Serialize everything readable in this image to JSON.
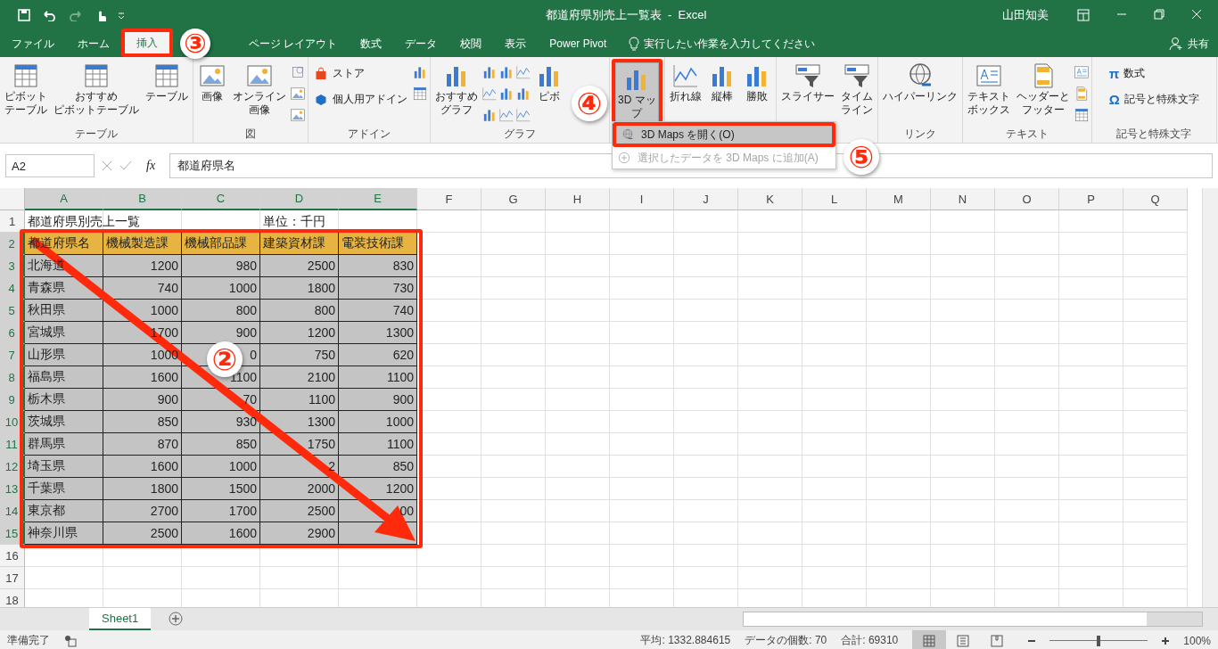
{
  "window": {
    "title": "都道府県別売上一覧表  -  Excel",
    "user": "山田知美"
  },
  "menu_tabs": [
    {
      "label": "ファイル",
      "selected": false
    },
    {
      "label": "ホーム",
      "selected": false
    },
    {
      "label": "挿入",
      "selected": true
    },
    {
      "label": "ページ レイアウト",
      "selected": false
    },
    {
      "label": "数式",
      "selected": false
    },
    {
      "label": "データ",
      "selected": false
    },
    {
      "label": "校閲",
      "selected": false
    },
    {
      "label": "表示",
      "selected": false
    },
    {
      "label": "Power Pivot",
      "selected": false
    }
  ],
  "tell_me": {
    "placeholder": "実行したい作業を入力してください"
  },
  "share": "共有",
  "ribbon_groups": [
    {
      "label": "テーブル",
      "buttons": [
        {
          "lines": [
            "ピボット",
            "テーブル"
          ],
          "kind": "large",
          "pressed": false
        },
        {
          "lines": [
            "おすすめ",
            "ピボットテーブル"
          ],
          "kind": "large",
          "pressed": false
        },
        {
          "lines": [
            "テーブル"
          ],
          "kind": "large",
          "pressed": false
        }
      ]
    },
    {
      "label": "図",
      "buttons": [
        {
          "lines": [
            "画像"
          ],
          "kind": "large",
          "pressed": false
        },
        {
          "lines": [
            "オンライン",
            "画像"
          ],
          "kind": "large",
          "pressed": false
        }
      ]
    },
    {
      "label": "アドイン",
      "buttons": [
        {
          "lines": [
            "ストア"
          ],
          "kind": "small",
          "pressed": false
        },
        {
          "lines": [
            "個人用アドイン"
          ],
          "kind": "small",
          "pressed": false
        }
      ]
    },
    {
      "label": "グラフ",
      "buttons": [
        {
          "lines": [
            "おすすめ",
            "グラフ"
          ],
          "kind": "large",
          "pressed": false
        },
        {
          "lines": [
            "ピボ"
          ],
          "kind": "large",
          "pressed": false
        }
      ]
    },
    {
      "buttons": [
        {
          "lines": [
            "3D マッ",
            "プ"
          ],
          "kind": "large",
          "pressed": true
        }
      ]
    },
    {
      "buttons": [
        {
          "lines": [
            "折れ線"
          ],
          "kind": "large",
          "pressed": false
        },
        {
          "lines": [
            "縦棒"
          ],
          "kind": "large",
          "pressed": false
        },
        {
          "lines": [
            "勝敗"
          ],
          "kind": "large",
          "pressed": false
        }
      ]
    },
    {
      "buttons": [
        {
          "lines": [
            "スライサー"
          ],
          "kind": "large",
          "pressed": false
        },
        {
          "lines": [
            "タイム",
            "ライン"
          ],
          "kind": "large",
          "pressed": false
        }
      ]
    },
    {
      "label": "リンク",
      "buttons": [
        {
          "lines": [
            "ハイパーリンク"
          ],
          "kind": "large",
          "pressed": false
        }
      ]
    },
    {
      "label": "テキスト",
      "buttons": [
        {
          "lines": [
            "テキスト",
            "ボックス"
          ],
          "kind": "large",
          "pressed": false
        },
        {
          "lines": [
            "ヘッダーと",
            "フッター"
          ],
          "kind": "large",
          "pressed": false
        }
      ]
    },
    {
      "label": "記号と特殊文字",
      "buttons": [
        {
          "lines": [
            "数式"
          ],
          "glyph": "π",
          "kind": "small",
          "pressed": false
        },
        {
          "lines": [
            "記号と特殊文字"
          ],
          "glyph": "Ω",
          "kind": "small",
          "pressed": false
        }
      ]
    }
  ],
  "dropdown_menu": [
    {
      "label": "3D Maps を開く(O)",
      "disabled": false
    },
    {
      "label": "選択したデータを 3D Maps に追加(A)",
      "disabled": true
    }
  ],
  "formula_bar": {
    "name_box": "A2",
    "function_label": "fx",
    "value": "都道府県名"
  },
  "columns": [
    {
      "label": "A",
      "selected": true
    },
    {
      "label": "B",
      "selected": true
    },
    {
      "label": "C",
      "selected": true
    },
    {
      "label": "D",
      "selected": true
    },
    {
      "label": "E",
      "selected": true
    },
    {
      "label": "F",
      "selected": false
    },
    {
      "label": "G",
      "selected": false
    },
    {
      "label": "H",
      "selected": false
    },
    {
      "label": "I",
      "selected": false
    },
    {
      "label": "J",
      "selected": false
    },
    {
      "label": "K",
      "selected": false
    },
    {
      "label": "L",
      "selected": false
    },
    {
      "label": "M",
      "selected": false
    },
    {
      "label": "N",
      "selected": false
    },
    {
      "label": "O",
      "selected": false
    },
    {
      "label": "P",
      "selected": false
    },
    {
      "label": "Q",
      "selected": false
    }
  ],
  "rows": [
    {
      "number": "1",
      "kind": "plain",
      "selected": false,
      "cells": [
        "都道府県別売上一覧",
        "",
        "",
        "単位：千円",
        ""
      ]
    },
    {
      "number": "2",
      "kind": "header",
      "selected": true,
      "cells": [
        "都道府県名",
        "機械製造課",
        "機械部品課",
        "建築資材課",
        "電装技術課"
      ]
    },
    {
      "number": "3",
      "kind": "data",
      "selected": true,
      "cells": [
        "北海道",
        "1200",
        "980",
        "2500",
        "830"
      ]
    },
    {
      "number": "4",
      "kind": "data",
      "selected": true,
      "cells": [
        "青森県",
        "740",
        "1000",
        "1800",
        "730"
      ]
    },
    {
      "number": "5",
      "kind": "data",
      "selected": true,
      "cells": [
        "秋田県",
        "1000",
        "800",
        "800",
        "740"
      ]
    },
    {
      "number": "6",
      "kind": "data",
      "selected": true,
      "cells": [
        "宮城県",
        "1700",
        "900",
        "1200",
        "1300"
      ]
    },
    {
      "number": "7",
      "kind": "data",
      "selected": true,
      "cells": [
        "山形県",
        "1000",
        "0",
        "750",
        "620"
      ]
    },
    {
      "number": "8",
      "kind": "data",
      "selected": true,
      "cells": [
        "福島県",
        "1600",
        "1100",
        "2100",
        "1100"
      ]
    },
    {
      "number": "9",
      "kind": "data",
      "selected": true,
      "cells": [
        "栃木県",
        "900",
        "70",
        "1100",
        "900"
      ]
    },
    {
      "number": "10",
      "kind": "data",
      "selected": true,
      "cells": [
        "茨城県",
        "850",
        "930",
        "1300",
        "1000"
      ]
    },
    {
      "number": "11",
      "kind": "data",
      "selected": true,
      "cells": [
        "群馬県",
        "870",
        "850",
        "1750",
        "1100"
      ]
    },
    {
      "number": "12",
      "kind": "data",
      "selected": true,
      "cells": [
        "埼玉県",
        "1600",
        "1000",
        "2",
        "850"
      ]
    },
    {
      "number": "13",
      "kind": "data",
      "selected": true,
      "cells": [
        "千葉県",
        "1800",
        "1500",
        "2000",
        "1200"
      ]
    },
    {
      "number": "14",
      "kind": "data",
      "selected": true,
      "cells": [
        "東京都",
        "2700",
        "1700",
        "2500",
        "00"
      ]
    },
    {
      "number": "15",
      "kind": "data",
      "selected": true,
      "cells": [
        "神奈川県",
        "2500",
        "1600",
        "2900",
        ""
      ]
    },
    {
      "number": "16",
      "kind": "plain",
      "selected": false,
      "cells": []
    },
    {
      "number": "17",
      "kind": "plain",
      "selected": false,
      "cells": []
    },
    {
      "number": "18",
      "kind": "plain",
      "selected": false,
      "cells": []
    }
  ],
  "sheet_tabs": [
    {
      "label": "Sheet1",
      "selected": true
    }
  ],
  "status_bar": {
    "ready": "準備完了",
    "average": "平均: 1332.884615",
    "count": "データの個数: 70",
    "sum": "合計: 69310",
    "views": [
      {
        "selected": true
      },
      {
        "selected": false
      },
      {
        "selected": false
      }
    ],
    "zoom_slider": {
      "level": 0.5
    },
    "zoom": "100%"
  },
  "annotations": [
    "②",
    "③",
    "④",
    "⑤"
  ]
}
